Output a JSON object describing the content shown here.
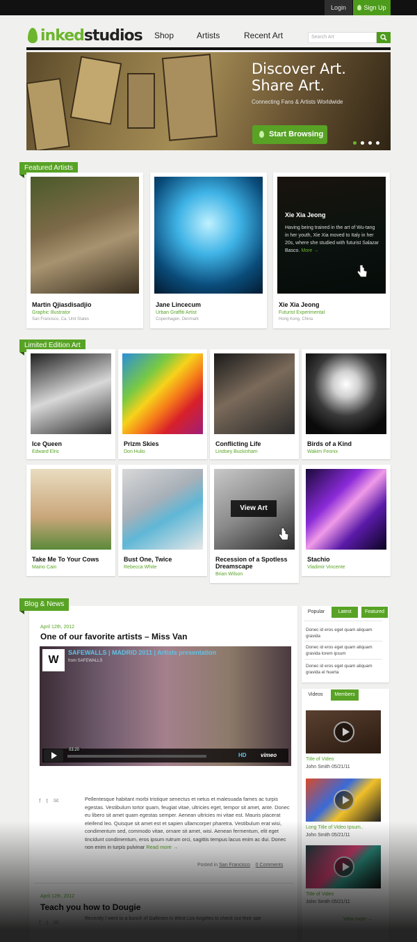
{
  "header": {
    "login_label": "Login",
    "signup_label": "Sign Up",
    "logo_part1": "inked",
    "logo_part2": "studios",
    "nav": [
      "Shop",
      "Artists",
      "Recent Art"
    ],
    "search_placeholder": "Search Art"
  },
  "hero": {
    "headline": "Discover Art. Share Art.",
    "tagline": "Connecting Fans & Artists Worldwide",
    "cta_label": "Start Browsing",
    "slide_count": 4,
    "active_slide": 1
  },
  "featured": {
    "heading": "Featured Artists",
    "artists": [
      {
        "name": "Martin Qjiasdisadjio",
        "role": "Graphic Illustrator",
        "location": "San Francisco, Ca, Unit States"
      },
      {
        "name": "Jane Lincecum",
        "role": "Urban Graffiti Artist",
        "location": "Copenhagen, Denmark"
      },
      {
        "name": "Xie Xia Jeong",
        "role": "Futurist Experimental",
        "location": "Hong Kong, China",
        "overlay_bio": "Having being trained in the art of Wu-tang in her youth, Xie Xia moved to Italy in her 20s, where she studied with futurist Salazar Basco.",
        "overlay_more": "More →"
      }
    ]
  },
  "limited": {
    "heading": "Limited Edition Art",
    "view_label": "View Art",
    "items": [
      {
        "title": "Ice Queen",
        "artist": "Edward Elric"
      },
      {
        "title": "Prizm Skies",
        "artist": "Don Hulio"
      },
      {
        "title": "Conflicting Life",
        "artist": "Lindsey Buckinham"
      },
      {
        "title": "Birds of a Kind",
        "artist": "Wakim Feonix"
      },
      {
        "title": "Take Me To Your Cows",
        "artist": "Maino Cain"
      },
      {
        "title": "Bust One, Twice",
        "artist": "Rebecca White"
      },
      {
        "title": "Recession of a Spotless Dreamscape",
        "artist": "Brian Wilson"
      },
      {
        "title": "Stachio",
        "artist": "Vladimir Vincente"
      }
    ]
  },
  "blog": {
    "heading": "Blog & News",
    "post": {
      "date": "April 12th, 2012",
      "title": "One of our favorite artists – Miss Van",
      "video_title": "SAFEWALLS | MADRID 2011 | Artists presentation",
      "video_from": "from SAFEWALLS",
      "video_time": "03:20",
      "video_hd": "HD",
      "video_brand": "vimeo",
      "body": "Pellentesque habitant morbi tristique senectus et netus et malesuada fames ac turpis egestas. Vestibulum tortor quam, feugiat vitae, ultricies eget, tempor sit amet, ante. Donec eu libero sit amet quam egestas semper. Aenean ultricies mi vitae est. Mauris placerat eleifend leo. Quisque sit amet est et sapien ullamcorper pharetra. Vestibulum erat wisi, condimentum sed, commodo vitae, ornare sit amet, wisi. Aenean fermentum, elit eget tincidunt condimentum, eros ipsum rutrum orci, sagittis tempus lacus enim ac dui. Donec non enim in turpis pulvinar",
      "read_more": "Read more →",
      "posted_in_label": "Posted in",
      "category": "San Francisco",
      "comments": "0 Comments"
    },
    "post2": {
      "date": "April 12th, 2012",
      "title": "Teach you how to Dougie",
      "teaser": "Recently I went to a bunch of Galleries in West Los Angeles to check out their spe"
    }
  },
  "sidebar": {
    "tabs": [
      "Popular",
      "Latest",
      "Featured"
    ],
    "popular": [
      "Donec id eros eget quam aliquam gravida",
      "Donec id eros eget quam aliquam gravida lorem ipsum",
      "Donec id eros eget quam aliquam gravida el huerta"
    ],
    "video_tabs": [
      "Videos",
      "Members"
    ],
    "videos": [
      {
        "title": "Title of Video",
        "meta": "John Smith 05/21/11"
      },
      {
        "title": "Long Title of Video Ipsum..",
        "meta": "John Smith 05/21/11"
      },
      {
        "title": "Title of Video",
        "meta": "John Smith 05/21/11"
      }
    ],
    "view_more": "View more →"
  },
  "colors": {
    "accent": "#58a325",
    "dark": "#111111",
    "page_bg": "#f0f0ee"
  }
}
